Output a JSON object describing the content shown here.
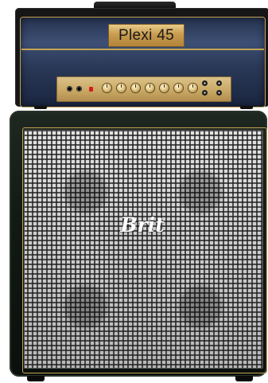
{
  "amp_head": {
    "model_name": "Plexi 45",
    "panel_color": "#2f4063",
    "piping_color": "#c6a255",
    "pilot_light_color": "#d61d1d",
    "input_jacks": 2,
    "knobs": 7,
    "toggle_switches": 4
  },
  "cabinet": {
    "brand_logo": "Brit",
    "speakers": 4,
    "grill_color": "#c8c8c8",
    "tolex_color": "#142017"
  }
}
